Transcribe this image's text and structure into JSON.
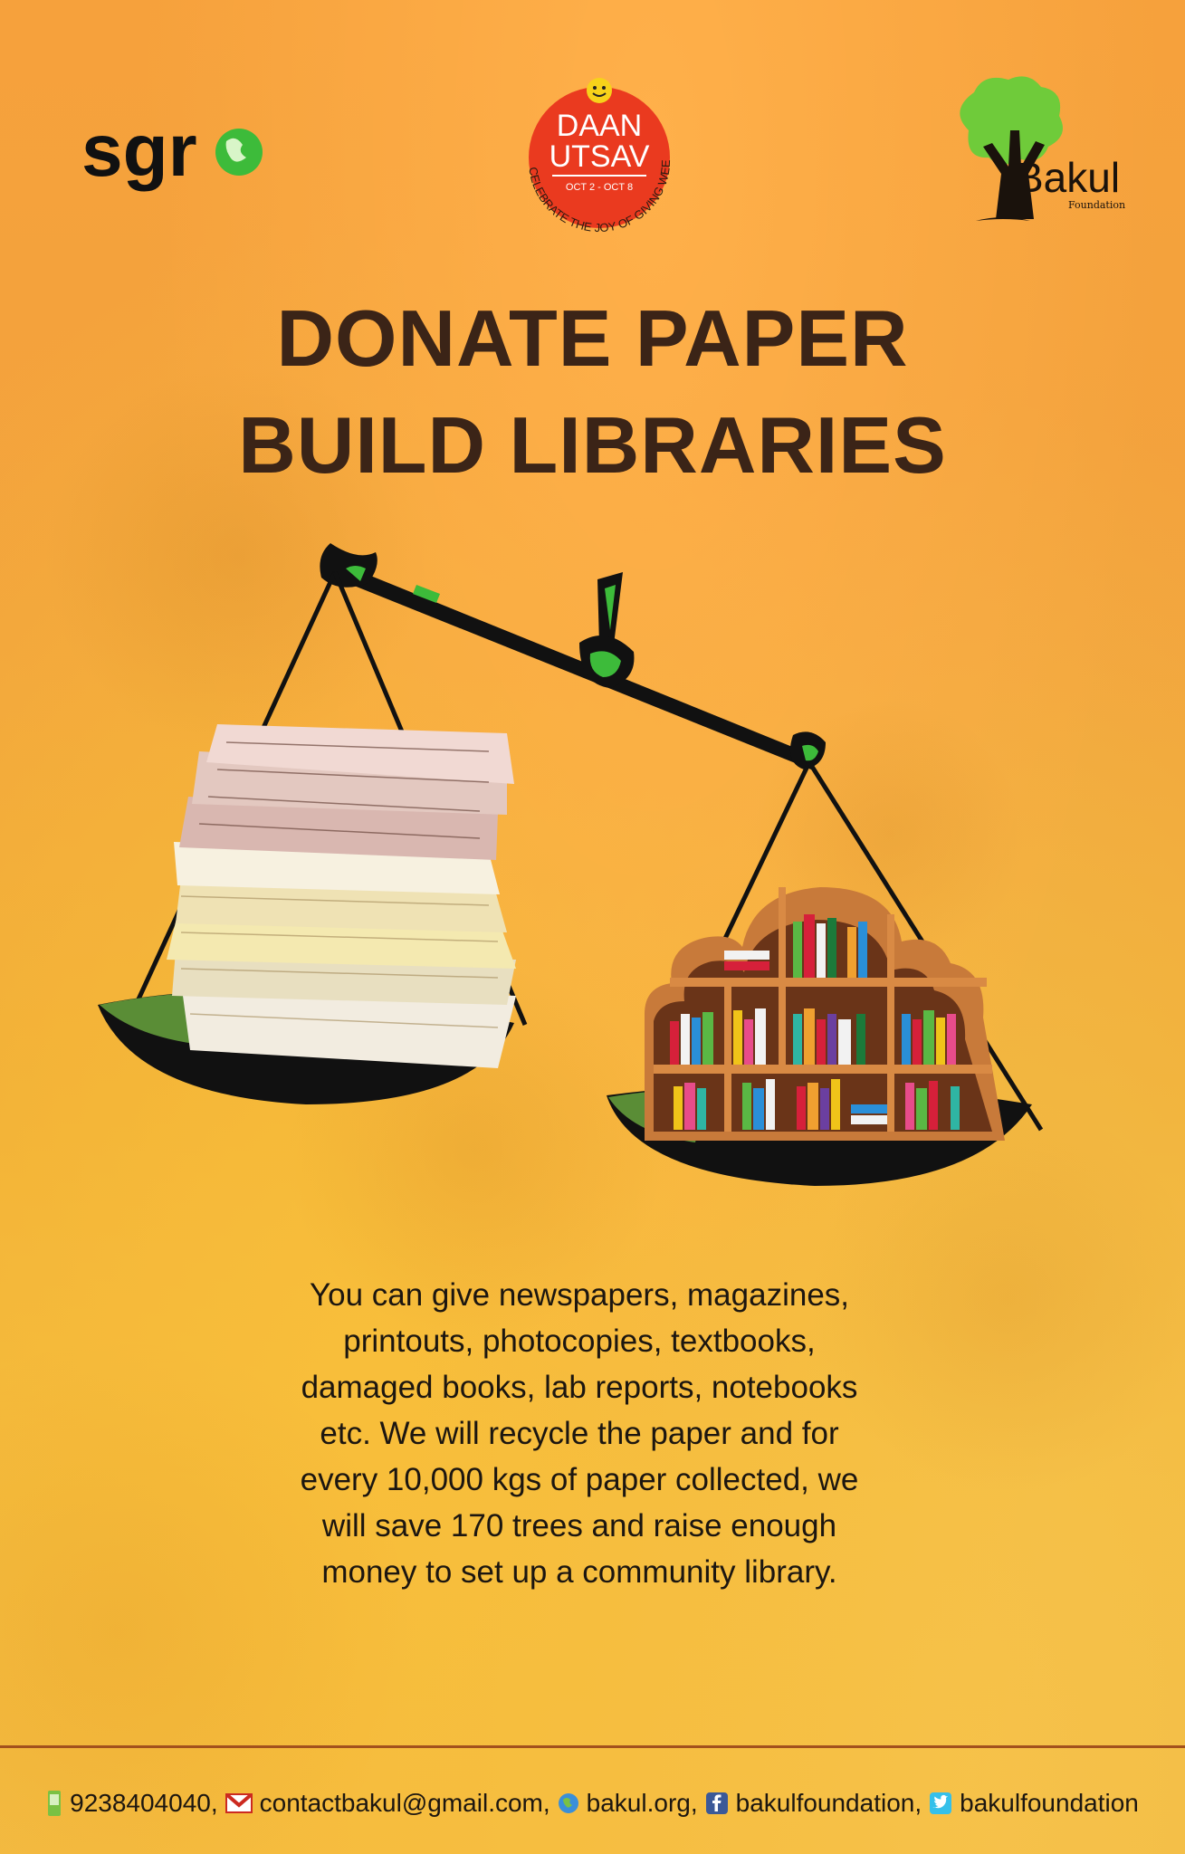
{
  "logos": {
    "sgr": {
      "text": "sgr"
    },
    "daan_utsav": {
      "line1": "DAAN",
      "line2": "UTSAV",
      "dates": "OCT 2 - OCT 8",
      "tagline": "CELEBRATE THE JOY OF GIVING WEEK"
    },
    "bakul": {
      "name": "Bakul",
      "sub": "Foundation"
    }
  },
  "headline": {
    "line1": "DONATE PAPER",
    "line2": "BUILD LIBRARIES"
  },
  "illustration": {
    "left_pan_contents": "stack of newspapers and paper",
    "right_pan_contents": "cloud-shaped bookshelf with books"
  },
  "body": "You can give newspapers, magazines, printouts, photocopies, textbooks, damaged books, lab reports, notebooks etc. We will recycle the paper and for every 10,000 kgs of paper collected, we will save 170 trees and raise enough money to set up a community library.",
  "footer": {
    "phone": "9238404040,",
    "email": "contactbakul@gmail.com,",
    "website": "bakul.org,",
    "facebook": "bakulfoundation,",
    "twitter": "bakulfoundation"
  },
  "colors": {
    "headline": "#3b2417",
    "accent_green": "#3dbb3a",
    "daan_red": "#ea3a1f",
    "divider": "#a2501d"
  },
  "icons": [
    "phone-icon",
    "email-icon",
    "globe-icon",
    "facebook-icon",
    "twitter-icon"
  ]
}
